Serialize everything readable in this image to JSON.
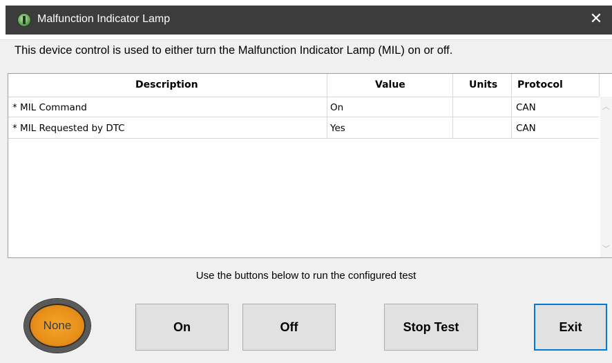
{
  "window": {
    "title": "Malfunction Indicator Lamp",
    "close_glyph": "✕"
  },
  "description": "This device control is used to either turn the Malfunction Indicator Lamp (MIL) on or off.",
  "grid": {
    "columns": [
      "Description",
      "Value",
      "Units",
      "Protocol"
    ],
    "rows": [
      {
        "description": "* MIL Command",
        "value": "On",
        "units": "",
        "protocol": "CAN"
      },
      {
        "description": "* MIL Requested by DTC",
        "value": "Yes",
        "units": "",
        "protocol": "CAN"
      }
    ]
  },
  "hint": "Use the buttons below to run the configured test",
  "lamp": {
    "label": "None",
    "color": "#e8901a"
  },
  "buttons": {
    "on": "On",
    "off": "Off",
    "stop": "Stop Test",
    "exit": "Exit"
  },
  "icons": {
    "app": "app-logo-icon",
    "close": "close-icon",
    "scroll_up": "chevron-up-icon",
    "scroll_down": "chevron-down-icon"
  },
  "colors": {
    "titlebar": "#3c3c3c",
    "default_button_border": "#0078d7"
  }
}
